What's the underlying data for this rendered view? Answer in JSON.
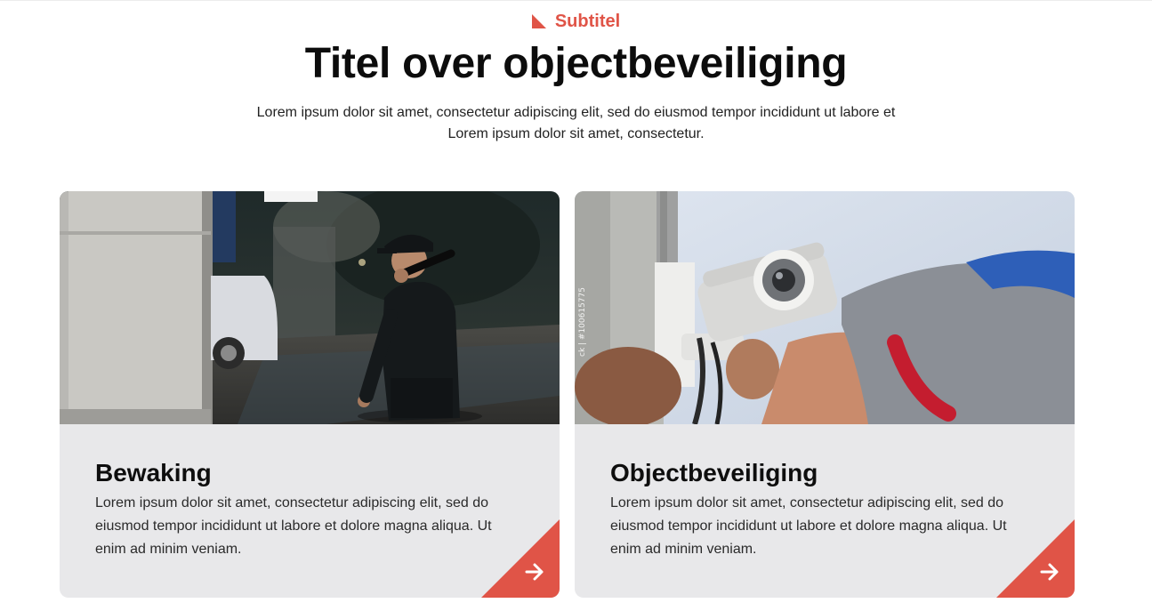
{
  "header": {
    "subtitle": "Subtitel",
    "subtitle_icon": "corner-triangle-icon",
    "title": "Titel over objectbeveiliging",
    "intro": "Lorem ipsum dolor sit amet, consectetur adipiscing elit, sed do eiusmod tempor incididunt ut labore et Lorem ipsum dolor sit amet, consectetur."
  },
  "cards": [
    {
      "title": "Bewaking",
      "text": "Lorem ipsum dolor sit amet, consectetur adipiscing elit, sed do eiusmod tempor incididunt ut labore et dolore magna aliqua. Ut enim ad minim veniam.",
      "image": "security-guard-night-photo",
      "link_icon": "arrow-right-icon"
    },
    {
      "title": "Objectbeveiliging",
      "text": "Lorem ipsum dolor sit amet, consectetur adipiscing elit, sed do eiusmod tempor incididunt ut labore et dolore magna aliqua. Ut enim ad minim veniam.",
      "image": "cctv-camera-installation-photo",
      "image_watermark": "ck | #100615775",
      "link_icon": "arrow-right-icon"
    }
  ],
  "colors": {
    "accent": "#e05447",
    "card_background": "#e8e8ea",
    "text": "#111111"
  }
}
